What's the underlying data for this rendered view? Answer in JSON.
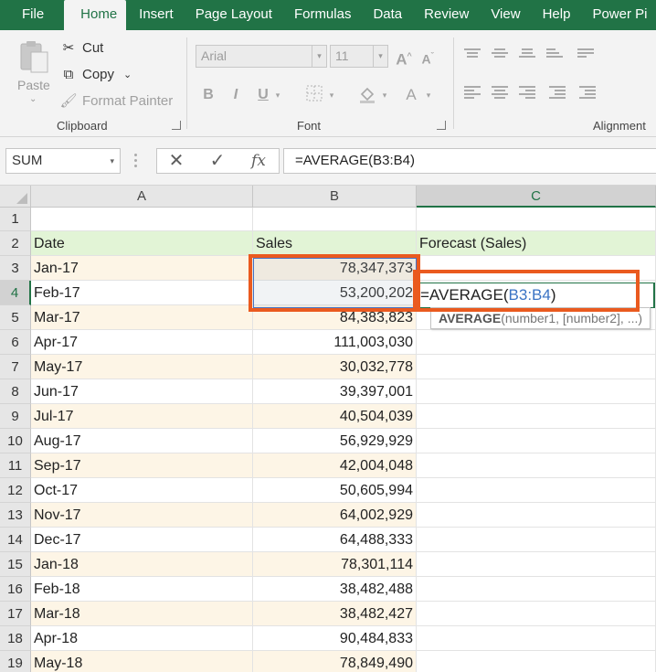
{
  "tabs": [
    {
      "label": "File"
    },
    {
      "label": "Home"
    },
    {
      "label": "Insert"
    },
    {
      "label": "Page Layout"
    },
    {
      "label": "Formulas"
    },
    {
      "label": "Data"
    },
    {
      "label": "Review"
    },
    {
      "label": "View"
    },
    {
      "label": "Help"
    },
    {
      "label": "Power Pi"
    }
  ],
  "active_tab": "Home",
  "ribbon": {
    "clipboard": {
      "paste_label": "Paste",
      "cut_label": "Cut",
      "copy_label": "Copy",
      "format_painter_label": "Format Painter",
      "group_label": "Clipboard"
    },
    "font": {
      "font_name": "Arial",
      "font_size": "11",
      "bold": "B",
      "italic": "I",
      "underline": "U",
      "font_color_glyph": "A",
      "group_label": "Font"
    },
    "alignment": {
      "group_label": "Alignment"
    }
  },
  "formula_bar": {
    "name_box": "SUM",
    "cancel_glyph": "✕",
    "enter_glyph": "✓",
    "fx_glyph": "fx",
    "formula": "=AVERAGE(B3:B4)"
  },
  "sheet": {
    "columns": [
      "A",
      "B",
      "C"
    ],
    "selected_column": "C",
    "selected_row": "4",
    "headers": {
      "date": "Date",
      "sales": "Sales",
      "forecast": "Forecast (Sales)"
    },
    "rows": [
      {
        "num": "1",
        "date": "",
        "sales": ""
      },
      {
        "num": "2",
        "date": "Date",
        "sales": "Sales"
      },
      {
        "num": "3",
        "date": "Jan-17",
        "sales": "78,347,373"
      },
      {
        "num": "4",
        "date": "Feb-17",
        "sales": "53,200,202"
      },
      {
        "num": "5",
        "date": "Mar-17",
        "sales": "84,383,823"
      },
      {
        "num": "6",
        "date": "Apr-17",
        "sales": "111,003,030"
      },
      {
        "num": "7",
        "date": "May-17",
        "sales": "30,032,778"
      },
      {
        "num": "8",
        "date": "Jun-17",
        "sales": "39,397,001"
      },
      {
        "num": "9",
        "date": "Jul-17",
        "sales": "40,504,039"
      },
      {
        "num": "10",
        "date": "Aug-17",
        "sales": "56,929,929"
      },
      {
        "num": "11",
        "date": "Sep-17",
        "sales": "42,004,048"
      },
      {
        "num": "12",
        "date": "Oct-17",
        "sales": "50,605,994"
      },
      {
        "num": "13",
        "date": "Nov-17",
        "sales": "64,002,929"
      },
      {
        "num": "14",
        "date": "Dec-17",
        "sales": "64,488,333"
      },
      {
        "num": "15",
        "date": "Jan-18",
        "sales": "78,301,114"
      },
      {
        "num": "16",
        "date": "Feb-18",
        "sales": "38,482,488"
      },
      {
        "num": "17",
        "date": "Mar-18",
        "sales": "38,482,427"
      },
      {
        "num": "18",
        "date": "Apr-18",
        "sales": "90,484,833"
      },
      {
        "num": "19",
        "date": "May-18",
        "sales": "78,849,490"
      }
    ],
    "editing_cell": {
      "prefix": "=AVERAGE(",
      "ref": "B3:B4",
      "suffix": ")"
    },
    "tooltip": {
      "func": "AVERAGE",
      "args": "(number1, [number2], ...)"
    }
  },
  "colors": {
    "excel_green": "#217346",
    "header_row_fill": "#e2f4d6",
    "alt_row_fill": "#fdf5e6",
    "highlight_box": "#ea5a1f",
    "range_ref": "#3a73c4"
  }
}
